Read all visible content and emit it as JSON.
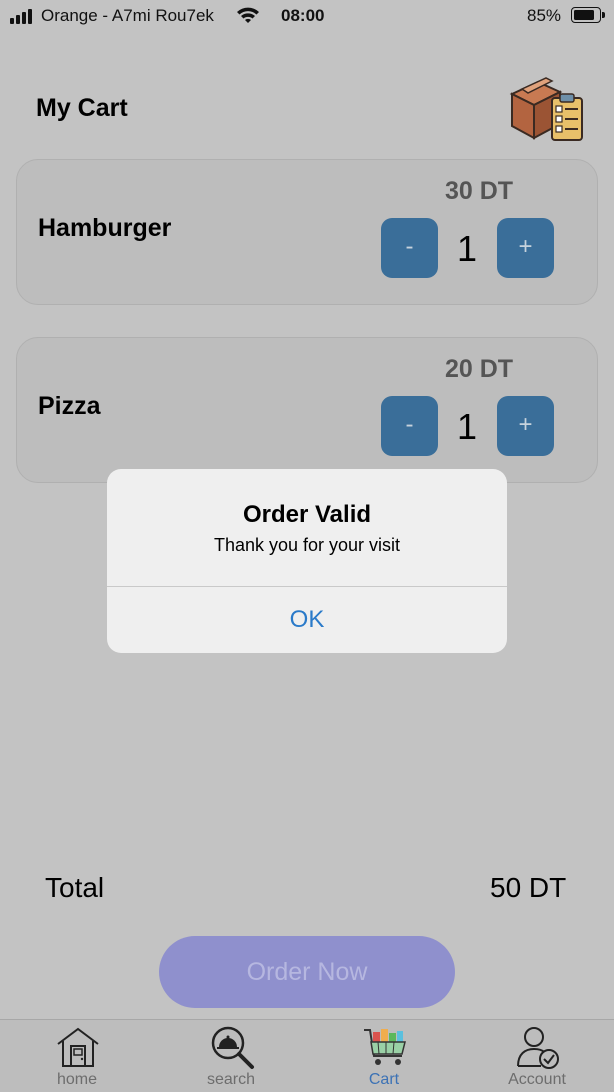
{
  "status_bar": {
    "carrier": "Orange - A7mi Rou7ek",
    "time": "08:00",
    "battery_percent": "85%",
    "signal_bars": 4,
    "battery_level": 0.85
  },
  "header": {
    "title": "My Cart",
    "icon": "cart-checklist-box-icon"
  },
  "cart": {
    "items": [
      {
        "name": "Hamburger",
        "price": "30 DT",
        "quantity": "1",
        "minus_label": "-",
        "plus_label": "+"
      },
      {
        "name": "Pizza",
        "price": "20 DT",
        "quantity": "1",
        "minus_label": "-",
        "plus_label": "+"
      }
    ]
  },
  "alert": {
    "title": "Order Valid",
    "message": "Thank you for your visit",
    "ok_label": "OK"
  },
  "total": {
    "label": "Total",
    "value": "50 DT"
  },
  "order_button": {
    "label": "Order Now"
  },
  "tab_bar": {
    "tabs": [
      {
        "label": "home",
        "icon": "house-icon",
        "active": false
      },
      {
        "label": "search",
        "icon": "search-icon",
        "active": false
      },
      {
        "label": "Cart",
        "icon": "shopping-cart-icon",
        "active": true
      },
      {
        "label": "Account",
        "icon": "account-icon",
        "active": false
      }
    ]
  },
  "colors": {
    "background": "#c3c3c3",
    "quantity_button": "#3a6e99",
    "order_button": "#8f90cd",
    "active_tab": "#3c72b5",
    "alert_button": "#2a7ac9"
  }
}
